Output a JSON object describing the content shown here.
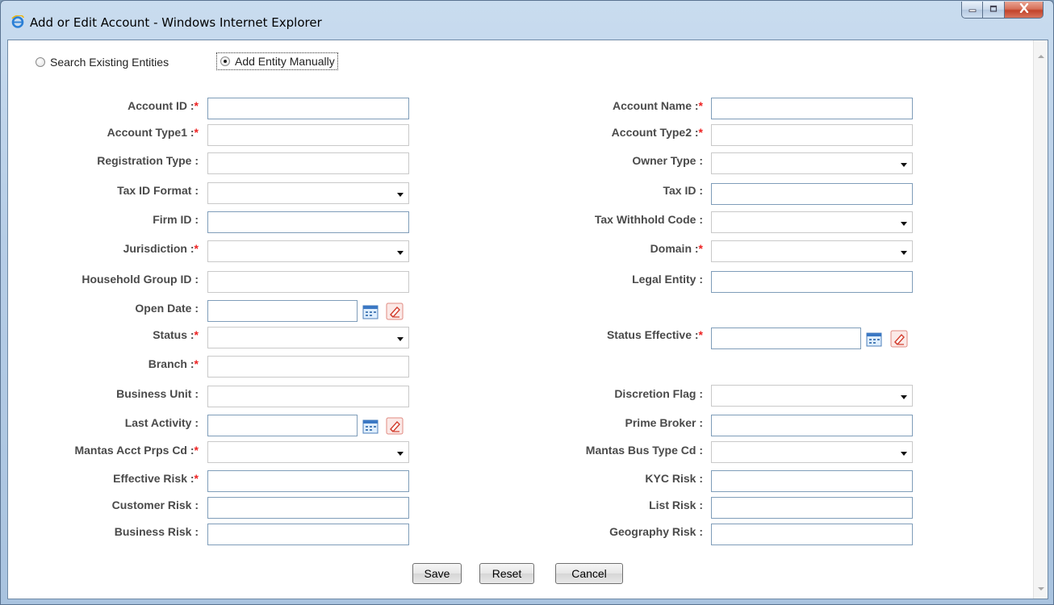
{
  "window": {
    "title": "Add or Edit Account - Windows Internet Explorer"
  },
  "mode": {
    "options": [
      {
        "label": "Search Existing Entities",
        "selected": false
      },
      {
        "label": "Add Entity Manually",
        "selected": true
      }
    ]
  },
  "form": {
    "account_id": {
      "label": "Account ID :",
      "required": "*",
      "value": ""
    },
    "account_name": {
      "label": "Account Name :",
      "required": "*",
      "value": ""
    },
    "account_type1": {
      "label": "Account Type1 :",
      "required": "*",
      "value": ""
    },
    "account_type2": {
      "label": "Account Type2 :",
      "required": "*",
      "value": ""
    },
    "registration_type": {
      "label": "Registration Type :",
      "value": ""
    },
    "owner_type": {
      "label": "Owner Type :",
      "value": ""
    },
    "tax_id_format": {
      "label": "Tax ID Format :",
      "value": ""
    },
    "tax_id": {
      "label": "Tax ID :",
      "value": ""
    },
    "firm_id": {
      "label": "Firm ID :",
      "value": ""
    },
    "tax_withhold_code": {
      "label": "Tax Withhold Code :",
      "value": ""
    },
    "jurisdiction": {
      "label": "Jurisdiction :",
      "required": "*",
      "value": ""
    },
    "domain": {
      "label": "Domain :",
      "required": "*",
      "value": ""
    },
    "household_group_id": {
      "label": "Household Group ID :",
      "value": ""
    },
    "legal_entity": {
      "label": "Legal Entity :",
      "value": ""
    },
    "open_date": {
      "label": "Open Date :",
      "value": ""
    },
    "status": {
      "label": "Status :",
      "required": "*",
      "value": ""
    },
    "status_effective": {
      "label": "Status Effective :",
      "required": "*",
      "value": ""
    },
    "branch": {
      "label": "Branch :",
      "required": "*",
      "value": ""
    },
    "business_unit": {
      "label": "Business Unit :",
      "value": ""
    },
    "discretion_flag": {
      "label": "Discretion Flag :",
      "value": ""
    },
    "last_activity": {
      "label": "Last Activity :",
      "value": ""
    },
    "prime_broker": {
      "label": "Prime Broker :",
      "value": ""
    },
    "mantas_acct_prps_cd": {
      "label": "Mantas Acct Prps Cd :",
      "required": "*",
      "value": ""
    },
    "mantas_bus_type_cd": {
      "label": "Mantas Bus Type Cd :",
      "value": ""
    },
    "effective_risk": {
      "label": "Effective Risk :",
      "required": "*",
      "value": ""
    },
    "kyc_risk": {
      "label": "KYC Risk :",
      "value": ""
    },
    "customer_risk": {
      "label": "Customer Risk :",
      "value": ""
    },
    "list_risk": {
      "label": "List Risk :",
      "value": ""
    },
    "business_risk": {
      "label": "Business Risk :",
      "value": ""
    },
    "geography_risk": {
      "label": "Geography Risk :",
      "value": ""
    }
  },
  "actions": {
    "save": "Save",
    "reset": "Reset",
    "cancel": "Cancel"
  },
  "icons": {
    "app": "internet-explorer-icon",
    "calendar": "calendar-icon",
    "clear": "eraser-icon"
  }
}
